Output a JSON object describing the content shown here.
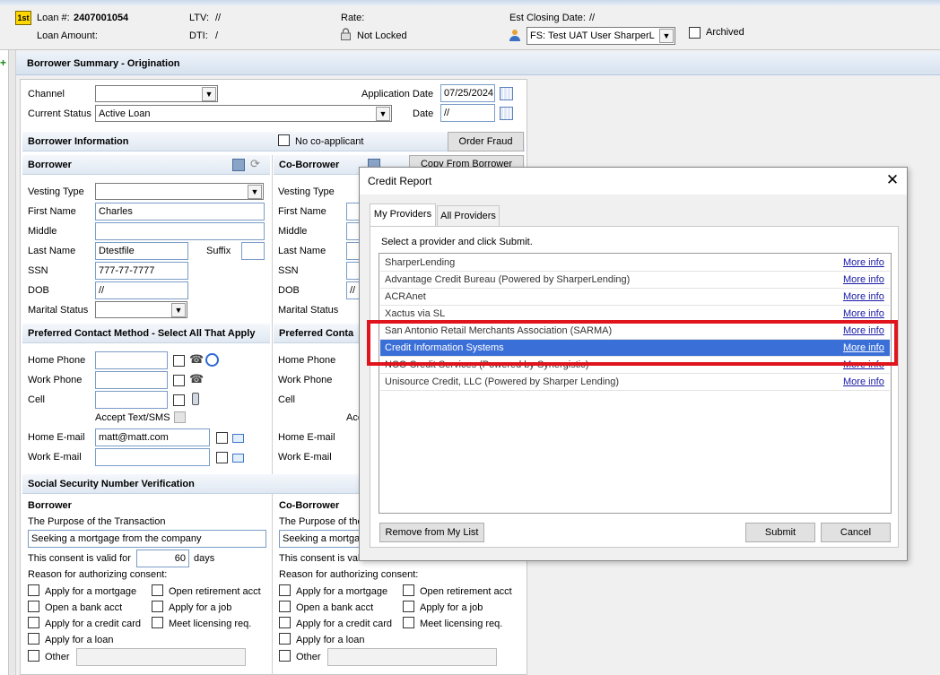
{
  "header": {
    "badge": "1st",
    "loan_label": "Loan #:",
    "loan_number": "2407001054",
    "loan_amount_label": "Loan Amount:",
    "ltv_label": "LTV:",
    "ltv_value": "//",
    "dti_label": "DTI:",
    "dti_value": "/",
    "rate_label": "Rate:",
    "lock_status": "Not Locked",
    "est_closing_label": "Est Closing Date:",
    "est_closing_value": "//",
    "user_value": "FS: Test UAT User SharperL",
    "archived_label": "Archived"
  },
  "panel": {
    "title": "Borrower Summary - Origination"
  },
  "top_fields": {
    "channel_label": "Channel",
    "channel_value": "",
    "current_status_label": "Current Status",
    "current_status_value": "Active Loan",
    "application_date_label": "Application Date",
    "application_date_value": "07/25/2024",
    "date_label": "Date",
    "date_value": "//"
  },
  "borrower_info": {
    "title": "Borrower Information",
    "no_coapplicant_label": "No co-applicant",
    "order_fraud_label": "Order Fraud"
  },
  "borrower": {
    "title": "Borrower",
    "vesting_type_label": "Vesting Type",
    "vesting_type_value": "",
    "first_name_label": "First Name",
    "first_name_value": "Charles",
    "middle_label": "Middle",
    "middle_value": "",
    "last_name_label": "Last Name",
    "last_name_value": "Dtestfile",
    "suffix_label": "Suffix",
    "suffix_value": "",
    "ssn_label": "SSN",
    "ssn_value": "777-77-7777",
    "dob_label": "DOB",
    "dob_value": "//",
    "marital_label": "Marital Status",
    "marital_value": ""
  },
  "coborrower": {
    "title": "Co-Borrower",
    "copy_button": "Copy From Borrower",
    "vesting_type_label": "Vesting Type",
    "first_name_label": "First Name",
    "middle_label": "Middle",
    "last_name_label": "Last Name",
    "ssn_label": "SSN",
    "dob_label": "DOB",
    "marital_label": "Marital Status",
    "dob_value": "//"
  },
  "contact": {
    "title": "Preferred Contact Method - Select All That Apply",
    "co_title": "Preferred Conta",
    "home_phone_label": "Home Phone",
    "work_phone_label": "Work Phone",
    "cell_label": "Cell",
    "accept_text_label": "Accept Text/SMS",
    "co_accept_partial": "Acc",
    "home_email_label": "Home E-mail",
    "home_email_value": "matt@matt.com",
    "work_email_label": "Work E-mail",
    "work_email_value": ""
  },
  "ssn_verify": {
    "title": "Social Security Number Verification",
    "borrower_title": "Borrower",
    "coborrower_title": "Co-Borrower",
    "purpose_label": "The Purpose of the Transaction",
    "purpose_value": "Seeking a mortgage from the company",
    "co_purpose_value": "Seeking a mortgag",
    "valid_for_label": "This consent is valid for",
    "valid_days_value": "60",
    "days_label": "days",
    "co_valid_label": "This consent is valid for",
    "reason_label": "Reason for authorizing consent:",
    "options": [
      "Apply for a mortgage",
      "Open retirement acct",
      "Open a bank acct",
      "Apply for a job",
      "Apply for a credit card",
      "Meet licensing req.",
      "Apply for a loan",
      "Other"
    ]
  },
  "dialog": {
    "title": "Credit Report",
    "tabs": [
      "My Providers",
      "All Providers"
    ],
    "instruction": "Select a provider and click Submit.",
    "more_info": "More info",
    "providers": [
      "SharperLending",
      "Advantage Credit Bureau (Powered by SharperLending)",
      "ACRAnet",
      "Xactus via SL",
      "San Antonio Retail Merchants Association (SARMA)",
      "Credit Information Systems",
      "NCO Credit Services (Powered by Synergistic)",
      "Unisource Credit, LLC (Powered by Sharper Lending)"
    ],
    "selected_index": 5,
    "remove_button": "Remove from My List",
    "submit_button": "Submit",
    "cancel_button": "Cancel"
  },
  "colors": {
    "header_bg": "#f0f0f0",
    "selection": "#3b6fd8",
    "highlight_box": "#e0141c",
    "link": "#1a1aa6"
  }
}
